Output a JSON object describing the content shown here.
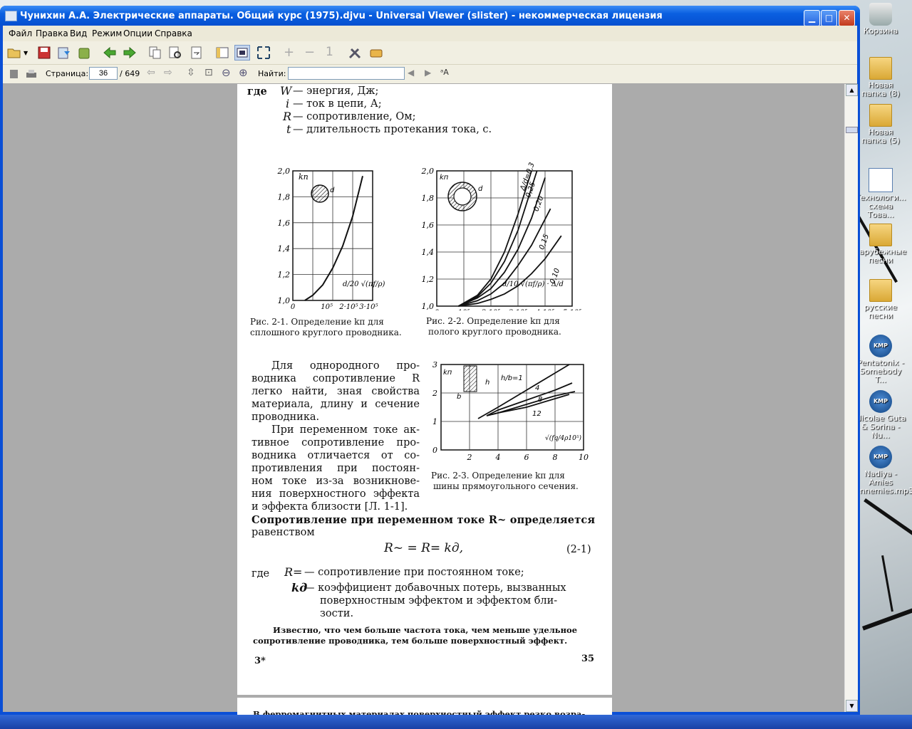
{
  "window": {
    "title": "Чунихин А.А. Электрические аппараты. Общий курс (1975).djvu - Universal Viewer (slister) - некоммерческая лицензия"
  },
  "menu": [
    "Файл",
    "Правка",
    "Вид",
    "Режим",
    "Опции",
    "Справка"
  ],
  "nav": {
    "page_label": "Страница:",
    "page_value": "36",
    "page_total": "/ 649",
    "find_label": "Найти:",
    "find_value": ""
  },
  "desktop_icons": [
    {
      "label": "Корзина",
      "icon": "recycle-bin"
    },
    {
      "label": "Новая папка (8)",
      "icon": "folder"
    },
    {
      "label": "Новая папка (5)",
      "icon": "folder"
    },
    {
      "label": "Технологи... схема Това...",
      "icon": "document"
    },
    {
      "label": "зарубежные песни",
      "icon": "folder"
    },
    {
      "label": "русские песни",
      "icon": "folder"
    },
    {
      "label": "Pentatonix - Somebody T...",
      "icon": "kmp"
    },
    {
      "label": "Nicolae Guta & Sorina - Nu...",
      "icon": "kmp"
    },
    {
      "label": "Nadiya - Amies ennemies.mp3",
      "icon": "kmp"
    }
  ],
  "document": {
    "where_word": "где",
    "defs": [
      {
        "sym": "W",
        "text": "— энергия, Дж;"
      },
      {
        "sym": "i",
        "text": "— ток в цепи, А;"
      },
      {
        "sym": "R",
        "text": "— сопротивление, Ом;"
      },
      {
        "sym": "t",
        "text": "— длительность протекания тока, с."
      }
    ],
    "fig1_caption_1": "Рис. 2-1. Определение kп для",
    "fig1_caption_2": "сплошного круглого проводника.",
    "fig2_caption_1": "Рис. 2-2. Определение kп для",
    "fig2_caption_2": "полого круглого проводника.",
    "fig3_caption_1": "Рис. 2-3. Определение kп для",
    "fig3_caption_2": "шины прямоугольного сечения.",
    "para1": [
      "Для однородного про-",
      "водника сопротивление R",
      "легко найти, зная свойства",
      "материала, длину и сечение",
      "проводника."
    ],
    "para2": [
      "При переменном токе ак-",
      "тивное сопротивление про-",
      "водника отличается от со-",
      "противления при постоян-",
      "ном токе из-за возникнове-",
      "ния поверхностного эффекта",
      "и эффекта близости [Л. 1-1]."
    ],
    "para3_1": "Сопротивление при переменном токе R~ определяется",
    "para3_2": "равенством",
    "formula": "R~ = R= kд,",
    "formula_no": "(2-1)",
    "where2": "где",
    "def2_1_sym": "R=",
    "def2_1": "— сопротивление при постоянном токе;",
    "def2_2_sym": "kд",
    "def2_2": "— коэффициент добавочных потерь, вызванных",
    "def2_2b": "поверхностным эффектом и эффектом бли-",
    "def2_2c": "зости.",
    "small_1": "Известно, что чем больше частота тока, чем меньше удельное",
    "small_2": "сопротивление проводника, тем больше поверхностный эффект.",
    "page_left": "3*",
    "page_right": "35",
    "next_page_line": "В ферромагнитных материалах поверхностный эффект резко возра-"
  },
  "chart_data": [
    {
      "type": "line",
      "title": "",
      "ylabel": "kп",
      "xlabel": "d/20 √(πf/ρ)",
      "ylim": [
        1.0,
        2.0
      ],
      "y_ticks": [
        "1,0",
        "1,2",
        "1,4",
        "1,6",
        "1,8",
        "2,0"
      ],
      "x_ticks": [
        "0",
        "10⁵",
        "2·10⁵",
        "3·10⁵"
      ],
      "series": [
        {
          "x": [
            0.6,
            1.0,
            1.5,
            2.0,
            2.5,
            3.0,
            3.5
          ],
          "values": [
            1.0,
            1.04,
            1.12,
            1.25,
            1.42,
            1.65,
            1.96
          ]
        }
      ]
    },
    {
      "type": "line",
      "title": "",
      "ylabel": "kп",
      "xlabel": "d/10 √(πf/ρ) · Δ/d",
      "ylim": [
        1.0,
        2.0
      ],
      "y_ticks": [
        "1,0",
        "1,2",
        "1,4",
        "1,6",
        "1,8",
        "2,0"
      ],
      "x_ticks": [
        "0",
        "10⁵",
        "2 10⁵",
        "3 10⁵",
        "4 10⁵",
        "5·10⁵"
      ],
      "series": [
        {
          "name": "Δ/d=0,3",
          "x": [
            0.8,
            1.5,
            2.0,
            2.5,
            3.0,
            3.5
          ],
          "values": [
            1.0,
            1.08,
            1.2,
            1.4,
            1.68,
            2.0
          ]
        },
        {
          "name": "0,25",
          "x": [
            0.8,
            1.5,
            2.0,
            2.5,
            3.0,
            3.7
          ],
          "values": [
            1.0,
            1.07,
            1.17,
            1.33,
            1.56,
            2.0
          ]
        },
        {
          "name": "0,20",
          "x": [
            0.8,
            1.5,
            2.0,
            2.5,
            3.0,
            3.5,
            4.0
          ],
          "values": [
            1.0,
            1.06,
            1.13,
            1.25,
            1.42,
            1.65,
            1.95
          ]
        },
        {
          "name": "0,15",
          "x": [
            0.8,
            1.5,
            2.0,
            2.5,
            3.0,
            3.5,
            4.2
          ],
          "values": [
            1.0,
            1.04,
            1.09,
            1.17,
            1.3,
            1.45,
            1.72
          ]
        },
        {
          "name": "0,10",
          "x": [
            0.8,
            1.5,
            2.0,
            2.5,
            3.0,
            3.5,
            4.0,
            4.6
          ],
          "values": [
            1.0,
            1.02,
            1.05,
            1.09,
            1.15,
            1.24,
            1.35,
            1.52
          ]
        }
      ]
    },
    {
      "type": "line",
      "title": "",
      "ylabel": "kп",
      "xlabel": "√(fq/4ρ10⁵)",
      "ylim": [
        0,
        3
      ],
      "xlim": [
        0,
        10
      ],
      "y_ticks": [
        "0",
        "1",
        "2",
        "3"
      ],
      "x_ticks": [
        "2",
        "4",
        "6",
        "8",
        "10"
      ],
      "series": [
        {
          "name": "h/b=1",
          "x": [
            2.6,
            4,
            6,
            8,
            9.0
          ],
          "values": [
            1.1,
            1.5,
            2.1,
            2.7,
            3.0
          ]
        },
        {
          "name": "4",
          "x": [
            3.2,
            4,
            6,
            8,
            9.2
          ],
          "values": [
            1.2,
            1.4,
            1.75,
            2.1,
            2.35
          ]
        },
        {
          "name": "8",
          "x": [
            3.2,
            4,
            6,
            8,
            9.4
          ],
          "values": [
            1.2,
            1.3,
            1.6,
            1.9,
            2.05
          ]
        },
        {
          "name": "12",
          "x": [
            3.6,
            4,
            6,
            8,
            9.0
          ],
          "values": [
            1.25,
            1.3,
            1.5,
            1.8,
            1.95
          ]
        }
      ]
    }
  ]
}
